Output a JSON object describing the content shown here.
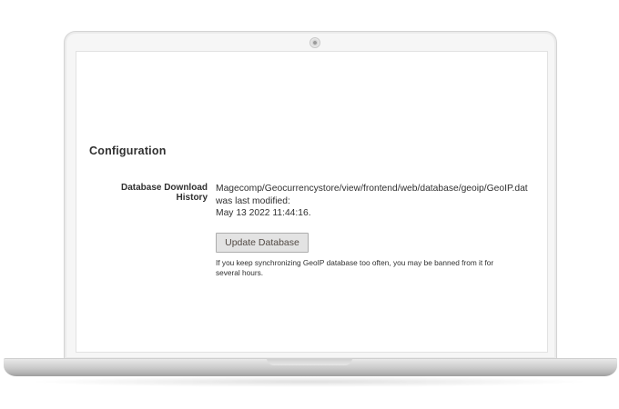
{
  "config": {
    "section_title": "Configuration",
    "field_label": "Database Download History",
    "file_path": "Magecomp/Geocurrencystore/view/frontend/web/database/geoip/GeoIP.dat",
    "modified_text": "was last modified:",
    "modified_date": "May 13 2022 11:44:16.",
    "update_button_label": "Update Database",
    "note_line1": "If you keep synchronizing GeoIP database too often, you may be banned from it for",
    "note_line2": "several hours."
  },
  "colors": {
    "text": "#303030",
    "button_bg": "#e3e3e3",
    "button_border": "#adadad",
    "bezel": "#f6f6f6"
  }
}
